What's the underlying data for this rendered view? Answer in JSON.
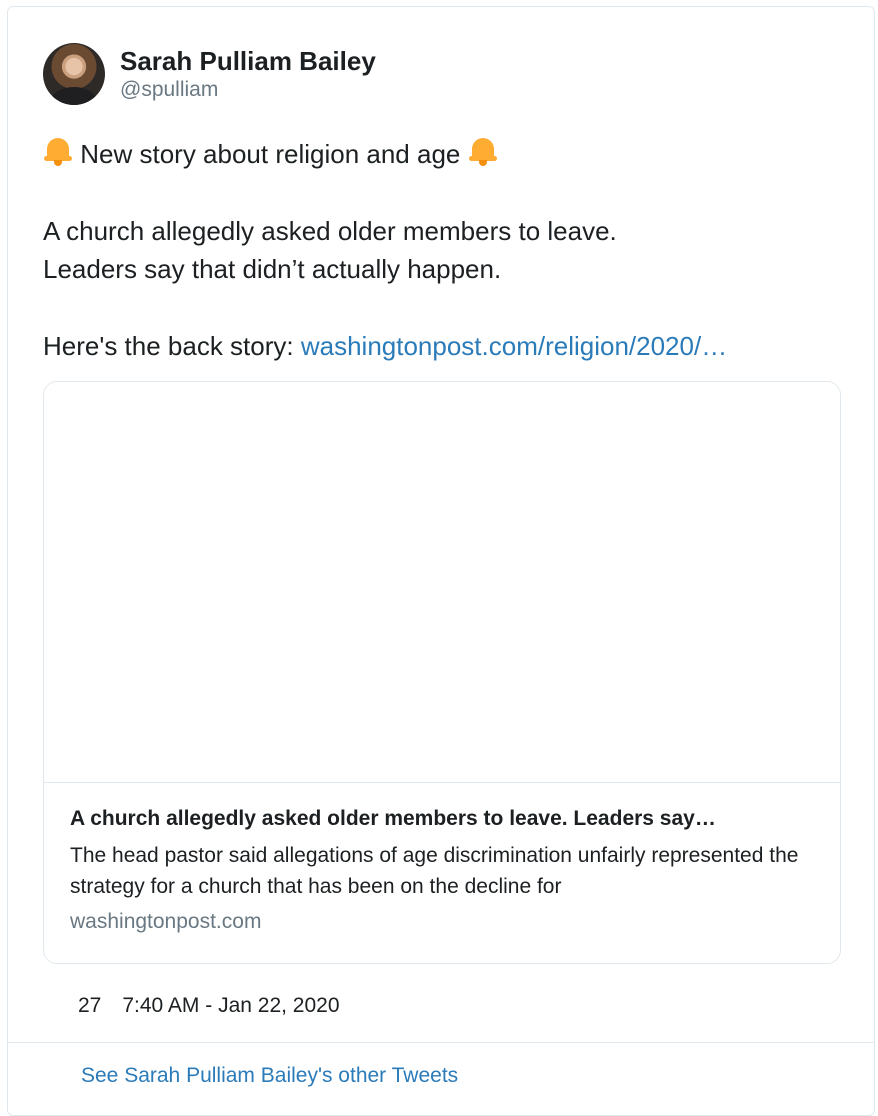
{
  "author": {
    "display_name": "Sarah Pulliam Bailey",
    "handle": "@spulliam"
  },
  "tweet": {
    "line1": "New story about religion and age",
    "line2": "A church allegedly asked older members to leave.",
    "line3": "Leaders say that didn’t actually happen.",
    "line4_prefix": "Here's the back story: ",
    "line4_link": "washingtonpost.com/religion/2020/…",
    "emoji_icon": "bell-icon"
  },
  "card": {
    "title": "A church allegedly asked older members to leave. Leaders say…",
    "description": "The head pastor said allegations of age discrimination unfairly represented the strategy for a church that has been on the decline for",
    "domain": "washingtonpost.com"
  },
  "meta": {
    "likes": "27",
    "timestamp": "7:40 AM - Jan 22, 2020"
  },
  "footer": {
    "link_label": "See Sarah Pulliam Bailey's other Tweets"
  },
  "colors": {
    "link": "#2b7bb9",
    "border": "#e1e8ed",
    "secondary_text": "#697882",
    "bell": "#ffac33"
  }
}
